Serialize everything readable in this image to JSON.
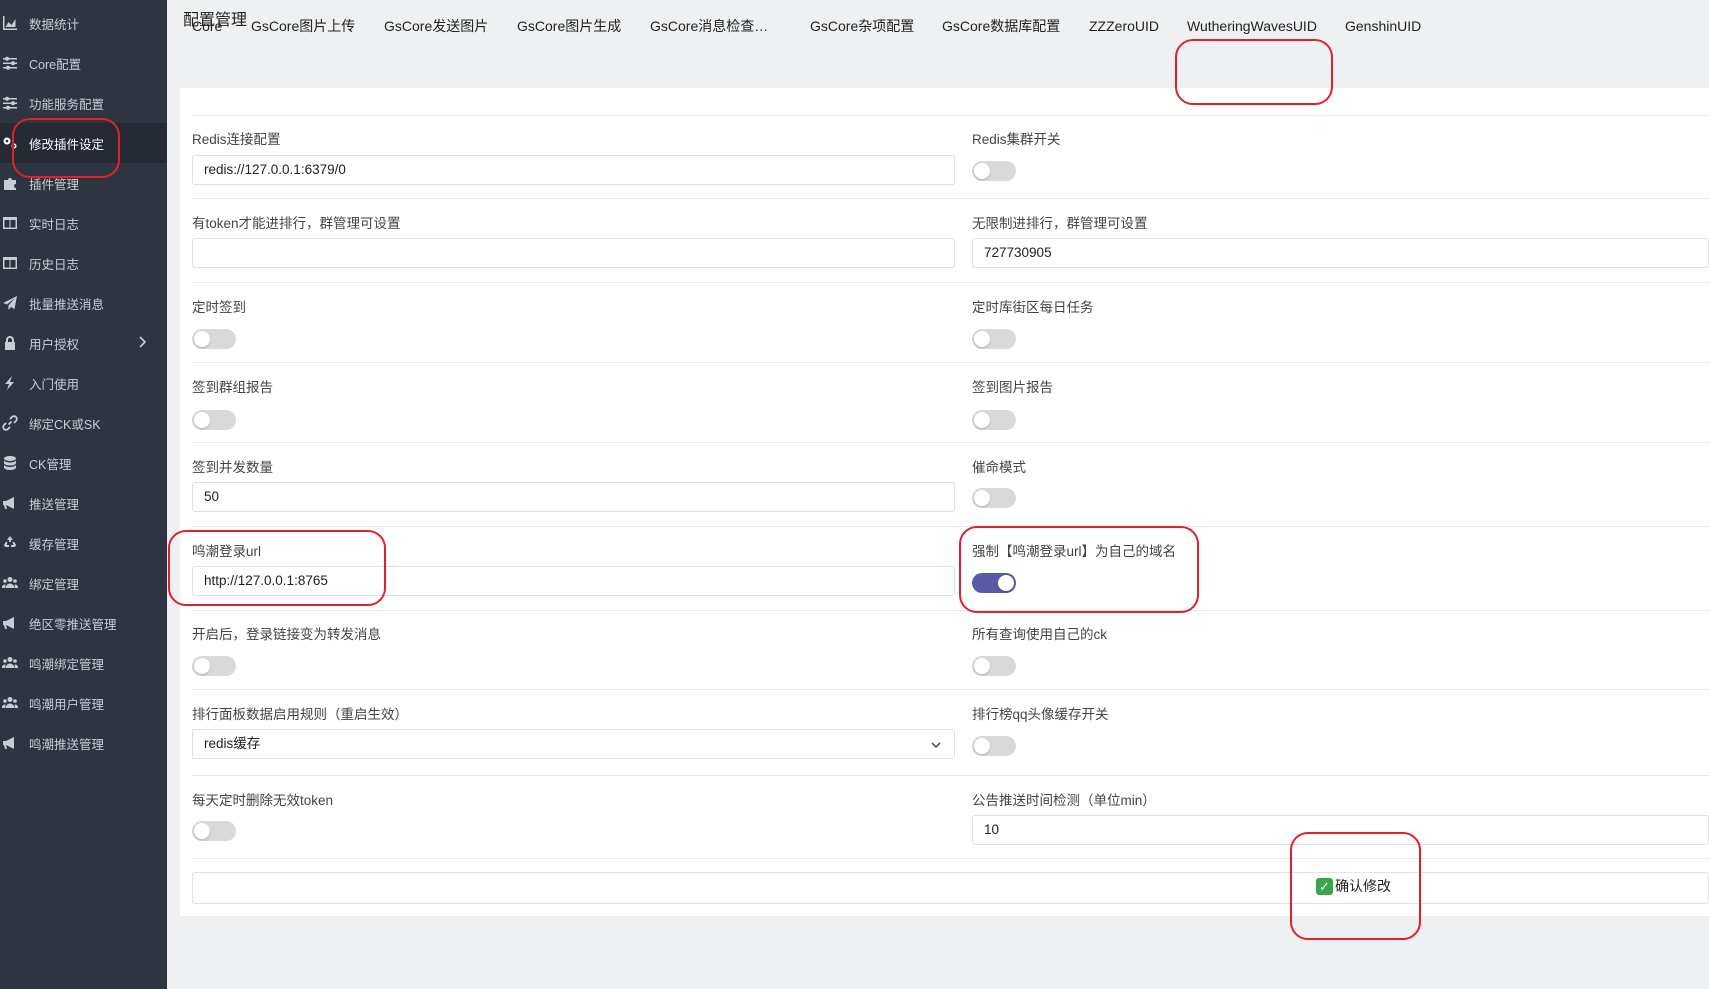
{
  "sidebar": {
    "items": [
      {
        "label": "数据统计",
        "icon": "chart-icon"
      },
      {
        "label": "Core配置",
        "icon": "sliders-icon"
      },
      {
        "label": "功能服务配置",
        "icon": "sliders-icon"
      },
      {
        "label": "修改插件设定",
        "icon": "gears-icon"
      },
      {
        "label": "插件管理",
        "icon": "puzzle-icon"
      },
      {
        "label": "实时日志",
        "icon": "columns-icon"
      },
      {
        "label": "历史日志",
        "icon": "columns-icon"
      },
      {
        "label": "批量推送消息",
        "icon": "send-icon"
      },
      {
        "label": "用户授权",
        "icon": "lock-icon"
      },
      {
        "label": "入门使用",
        "icon": "bolt-icon"
      },
      {
        "label": "绑定CK或SK",
        "icon": "link-icon"
      },
      {
        "label": "CK管理",
        "icon": "database-icon"
      },
      {
        "label": "推送管理",
        "icon": "megaphone-icon"
      },
      {
        "label": "缓存管理",
        "icon": "recycle-icon"
      },
      {
        "label": "绑定管理",
        "icon": "users-icon"
      },
      {
        "label": "绝区零推送管理",
        "icon": "megaphone-icon"
      },
      {
        "label": "鸣潮绑定管理",
        "icon": "users-icon"
      },
      {
        "label": "鸣潮用户管理",
        "icon": "users-icon"
      },
      {
        "label": "鸣潮推送管理",
        "icon": "megaphone-icon"
      }
    ]
  },
  "header": {
    "title": "配置管理"
  },
  "tabs": [
    "Core",
    "GsCore图片上传",
    "GsCore发送图片",
    "GsCore图片生成",
    "GsCore消息检查…",
    "GsCore杂项配置",
    "GsCore数据库配置",
    "ZZZeroUID",
    "WutheringWavesUID",
    "GenshinUID"
  ],
  "form": {
    "redis_conn": {
      "label": "Redis连接配置",
      "value": "redis://127.0.0.1:6379/0"
    },
    "redis_cluster": {
      "label": "Redis集群开关",
      "on": false
    },
    "token_rank": {
      "label": "有token才能进排行，群管理可设置",
      "value": ""
    },
    "unlimited_rank": {
      "label": "无限制进排行，群管理可设置",
      "value": "727730905"
    },
    "scheduled_sign": {
      "label": "定时签到",
      "on": false
    },
    "scheduled_daily": {
      "label": "定时库街区每日任务",
      "on": false
    },
    "sign_group_report": {
      "label": "签到群组报告",
      "on": false
    },
    "sign_image_report": {
      "label": "签到图片报告",
      "on": false
    },
    "sign_concurrency": {
      "label": "签到并发数量",
      "value": "50"
    },
    "urge_mode": {
      "label": "催命模式",
      "on": false
    },
    "login_url": {
      "label": "鸣潮登录url",
      "value": "http://127.0.0.1:8765"
    },
    "force_domain": {
      "label": "强制【鸣潮登录url】为自己的域名",
      "on": true
    },
    "forward_msg": {
      "label": "开启后，登录链接变为转发消息",
      "on": false
    },
    "own_ck": {
      "label": "所有查询使用自己的ck",
      "on": false
    },
    "rank_rule": {
      "label": "排行面板数据启用规则（重启生效）",
      "value": "redis缓存"
    },
    "avatar_cache": {
      "label": "排行榜qq头像缓存开关",
      "on": false
    },
    "delete_token": {
      "label": "每天定时删除无效token",
      "on": false
    },
    "notice_interval": {
      "label": "公告推送时间检测（单位min）",
      "value": "10"
    }
  },
  "confirm": {
    "label": "确认修改"
  },
  "colors": {
    "sidebar_bg": "#2f3441",
    "toggle_on": "#5b5aa6",
    "annotation": "#e0212a"
  }
}
